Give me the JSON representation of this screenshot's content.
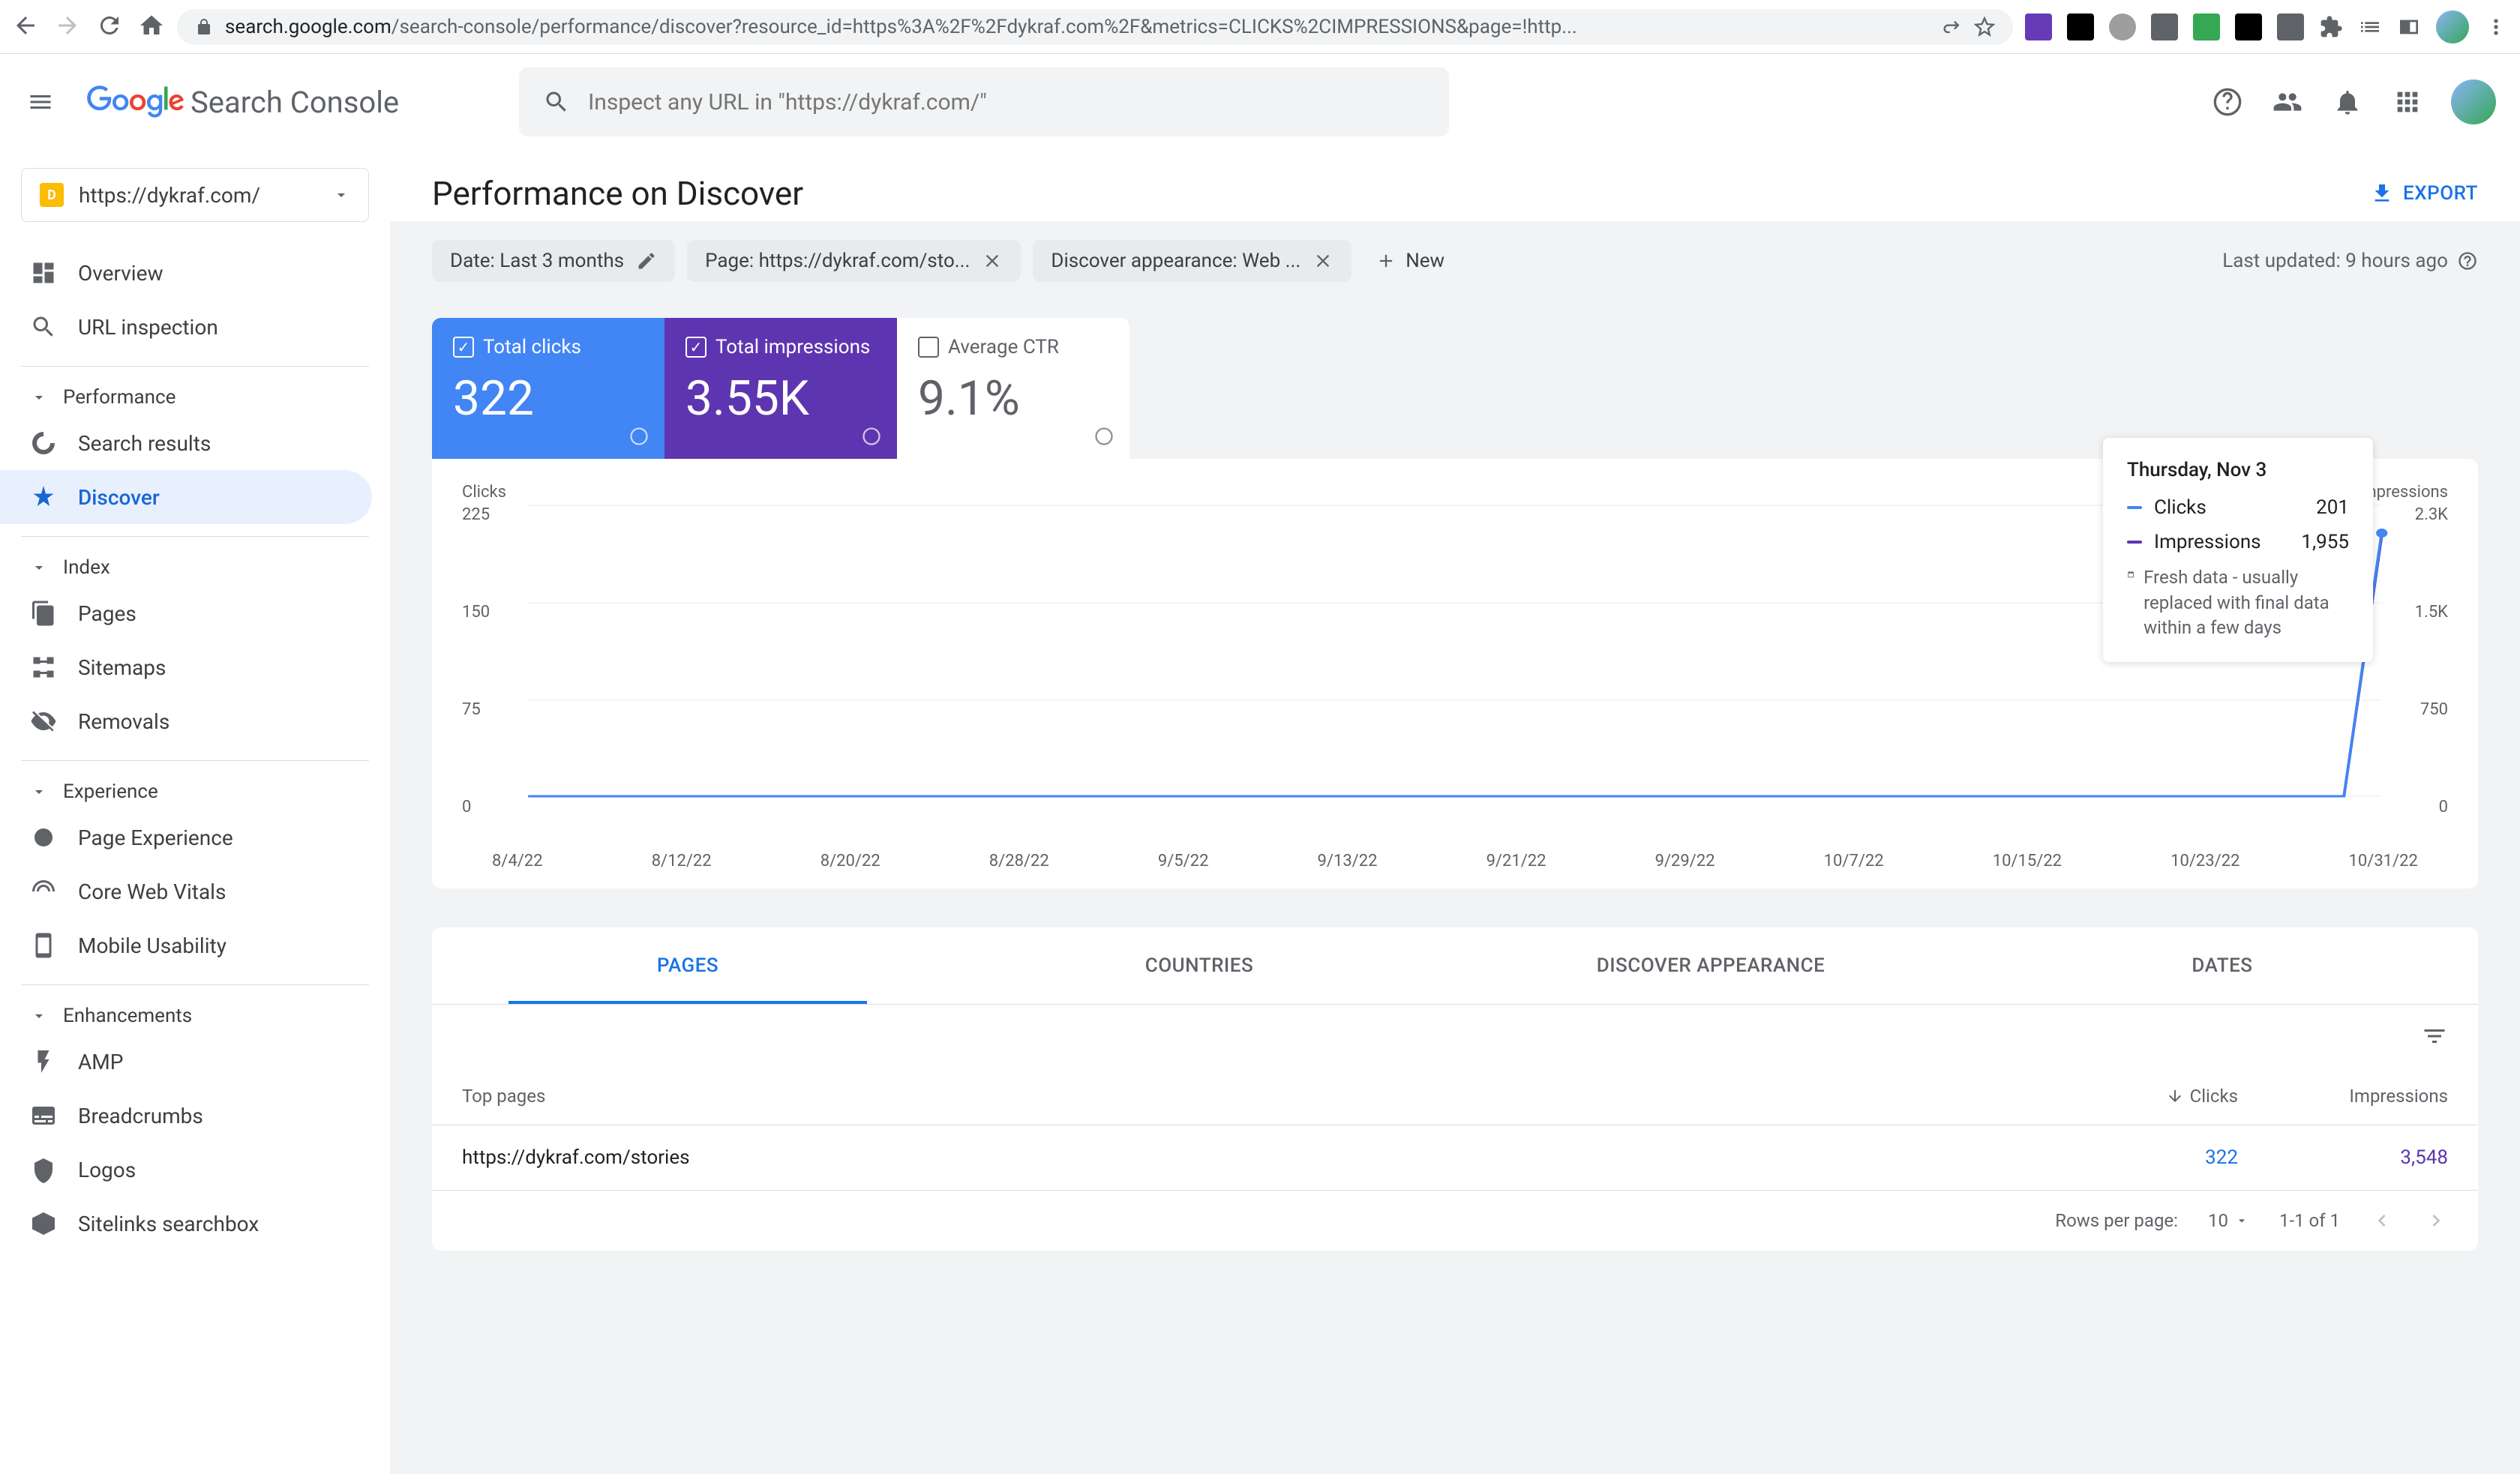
{
  "browser": {
    "url_host": "search.google.com",
    "url_path": "/search-console/performance/discover?resource_id=https%3A%2F%2Fdykraf.com%2F&metrics=CLICKS%2CIMPRESSIONS&page=!http..."
  },
  "header": {
    "product": "Search Console",
    "search_placeholder": "Inspect any URL in \"https://dykraf.com/\""
  },
  "sidebar": {
    "property": "https://dykraf.com/",
    "items": {
      "overview": "Overview",
      "url_inspection": "URL inspection",
      "performance_section": "Performance",
      "search_results": "Search results",
      "discover": "Discover",
      "index_section": "Index",
      "pages": "Pages",
      "sitemaps": "Sitemaps",
      "removals": "Removals",
      "experience_section": "Experience",
      "page_experience": "Page Experience",
      "core_web_vitals": "Core Web Vitals",
      "mobile_usability": "Mobile Usability",
      "enhancements_section": "Enhancements",
      "amp": "AMP",
      "breadcrumbs": "Breadcrumbs",
      "logos": "Logos",
      "sitelinks_searchbox": "Sitelinks searchbox"
    }
  },
  "page": {
    "title": "Performance on Discover",
    "export": "EXPORT",
    "updated": "Last updated: 9 hours ago"
  },
  "filters": {
    "date": "Date: Last 3 months",
    "page": "Page: https://dykraf.com/sto...",
    "appearance": "Discover appearance: Web ...",
    "new": "New"
  },
  "metrics": {
    "clicks_label": "Total clicks",
    "clicks_value": "322",
    "impressions_label": "Total impressions",
    "impressions_value": "3.55K",
    "ctr_label": "Average CTR",
    "ctr_value": "9.1%"
  },
  "tooltip": {
    "title": "Thursday, Nov 3",
    "clicks_label": "Clicks",
    "clicks_value": "201",
    "impressions_label": "Impressions",
    "impressions_value": "1,955",
    "note": "Fresh data - usually replaced with final data within a few days"
  },
  "chart_data": {
    "type": "line",
    "x_categories": [
      "8/4/22",
      "8/12/22",
      "8/20/22",
      "8/28/22",
      "9/5/22",
      "9/13/22",
      "9/21/22",
      "9/29/22",
      "10/7/22",
      "10/15/22",
      "10/23/22",
      "10/31/22"
    ],
    "y_left_label": "Clicks",
    "y_left_ticks": [
      0,
      75,
      150,
      225
    ],
    "y_right_label": "Impressions",
    "y_right_ticks": [
      0,
      750,
      "1.5K",
      "2.3K"
    ],
    "series": [
      {
        "name": "Clicks",
        "color": "#4285f4",
        "values_by_x": {
          "8/4/22": 0,
          "10/31/22": 0,
          "11/3/22": 201
        }
      },
      {
        "name": "Impressions",
        "color": "#5e35b1",
        "values_by_x": {
          "8/4/22": 0,
          "10/31/22": 0,
          "11/3/22": 1955
        }
      }
    ],
    "note": "Series are flat at 0 until spike at end of range (Nov 3)."
  },
  "tabs": {
    "pages": "PAGES",
    "countries": "COUNTRIES",
    "appearance": "DISCOVER APPEARANCE",
    "dates": "DATES"
  },
  "table": {
    "header_page": "Top pages",
    "header_clicks": "Clicks",
    "header_impressions": "Impressions",
    "rows": [
      {
        "page": "https://dykraf.com/stories",
        "clicks": "322",
        "impressions": "3,548"
      }
    ],
    "rows_per_page_label": "Rows per page:",
    "rows_per_page": "10",
    "range": "1-1 of 1"
  }
}
